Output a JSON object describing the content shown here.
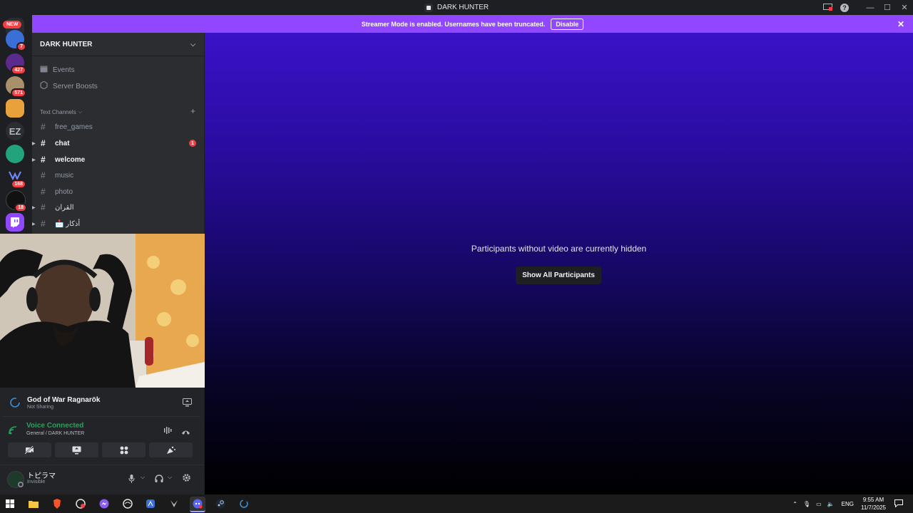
{
  "window": {
    "title": "DARK HUNTER"
  },
  "banner": {
    "text": "Streamer Mode is enabled. Usernames have been truncated.",
    "disable_label": "Disable"
  },
  "rail": {
    "new_label": "NEW",
    "servers": [
      {
        "badge": "7",
        "color": "#3a6fd8"
      },
      {
        "badge": "427",
        "color": "#5b2a8c"
      },
      {
        "badge": "571",
        "color": "#a8906a"
      },
      {
        "badge": "",
        "color": "#e9a23b"
      },
      {
        "badge": "",
        "color": "#2b2d31"
      },
      {
        "badge": "",
        "color": "#22a37b"
      },
      {
        "badge": "168",
        "color": "#1e1f22"
      },
      {
        "badge": "18",
        "color": "#111111"
      },
      {
        "badge": "",
        "color": "#9146ff"
      }
    ]
  },
  "sidebar": {
    "server_name": "DARK HUNTER",
    "events": "Events",
    "server_boosts": "Server Boosts",
    "category": "Text Channels",
    "channels": [
      {
        "name": "free_games",
        "unread": false,
        "arrow": false,
        "mention": ""
      },
      {
        "name": "chat",
        "unread": true,
        "arrow": true,
        "mention": "1"
      },
      {
        "name": "welcome",
        "unread": true,
        "arrow": true,
        "mention": ""
      },
      {
        "name": "music",
        "unread": false,
        "arrow": false,
        "mention": ""
      },
      {
        "name": "photo",
        "unread": false,
        "arrow": false,
        "mention": ""
      },
      {
        "name": "القران",
        "unread": false,
        "arrow": true,
        "mention": ""
      },
      {
        "name": "📩 أذكار",
        "unread": false,
        "arrow": true,
        "mention": ""
      }
    ]
  },
  "activity": {
    "game": "God of War Ragnarök",
    "status": "Not Sharing"
  },
  "voice": {
    "status": "Voice Connected",
    "channel": "General / DARK HUNTER"
  },
  "user": {
    "name": "トピラマ",
    "status": "Invisible"
  },
  "main": {
    "hidden_message": "Participants without video are currently hidden",
    "show_all_label": "Show All Participants"
  },
  "taskbar": {
    "lang": "ENG",
    "time": "9:55 AM",
    "date": "11/7/2025"
  },
  "colors": {
    "accent": "#9146ff",
    "voice_green": "#23a55a",
    "danger": "#f23f43"
  }
}
